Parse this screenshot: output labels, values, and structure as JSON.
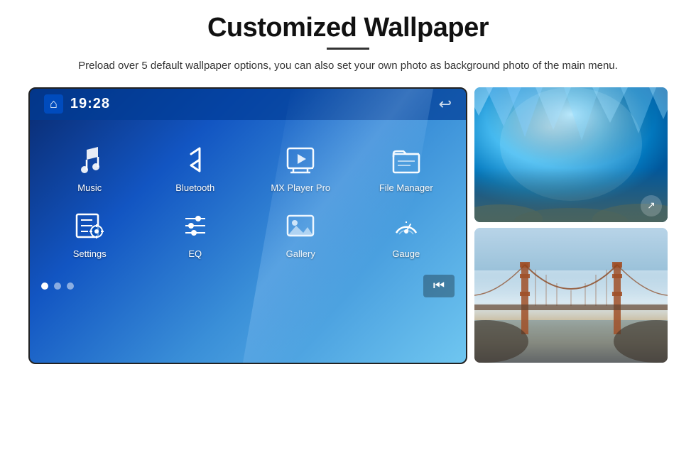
{
  "page": {
    "title": "Customized Wallpaper",
    "subtitle": "Preload over 5 default wallpaper options, you can also set your own photo as background photo of the main menu."
  },
  "screen": {
    "time": "19:28",
    "apps_row1": [
      {
        "id": "music",
        "label": "Music",
        "icon": "music"
      },
      {
        "id": "bluetooth",
        "label": "Bluetooth",
        "icon": "bluetooth"
      },
      {
        "id": "mxplayer",
        "label": "MX Player Pro",
        "icon": "player"
      },
      {
        "id": "filemanager",
        "label": "File Manager",
        "icon": "file"
      }
    ],
    "apps_row2": [
      {
        "id": "settings",
        "label": "Settings",
        "icon": "settings"
      },
      {
        "id": "eq",
        "label": "EQ",
        "icon": "eq"
      },
      {
        "id": "gallery",
        "label": "Gallery",
        "icon": "gallery"
      },
      {
        "id": "gauge",
        "label": "Gauge",
        "icon": "gauge"
      }
    ],
    "dots": [
      {
        "active": true
      },
      {
        "active": false
      },
      {
        "active": false
      }
    ]
  },
  "images": [
    {
      "id": "ice-cave",
      "alt": "Ice cave blue background"
    },
    {
      "id": "golden-gate",
      "alt": "Golden Gate Bridge foggy"
    }
  ]
}
